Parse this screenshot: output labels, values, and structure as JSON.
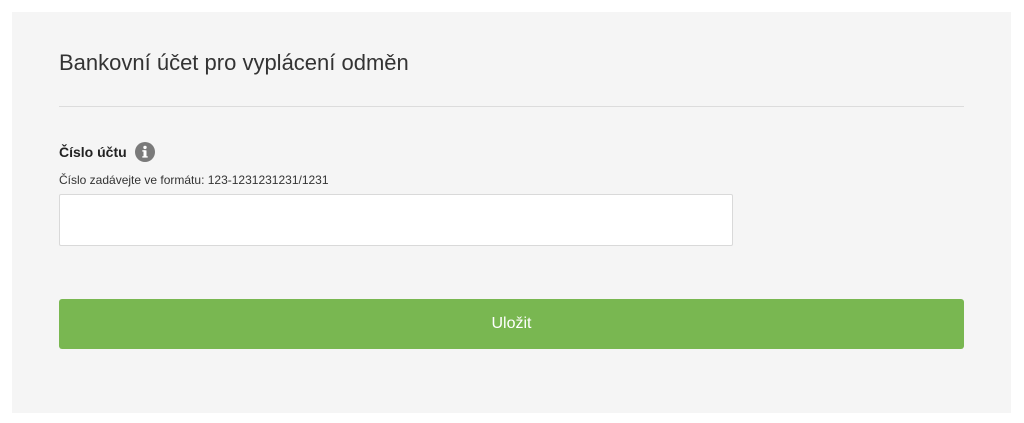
{
  "section": {
    "title": "Bankovní účet pro vyplácení odměn"
  },
  "account_field": {
    "label": "Číslo účtu",
    "info_icon": "info-icon",
    "hint": "Číslo zadávejte ve formátu: 123-1231231231/1231",
    "value": "",
    "placeholder": ""
  },
  "actions": {
    "save_label": "Uložit"
  },
  "colors": {
    "panel_background": "#f5f5f5",
    "button_accent": "#79b751",
    "info_icon": "#7a7a7a"
  }
}
